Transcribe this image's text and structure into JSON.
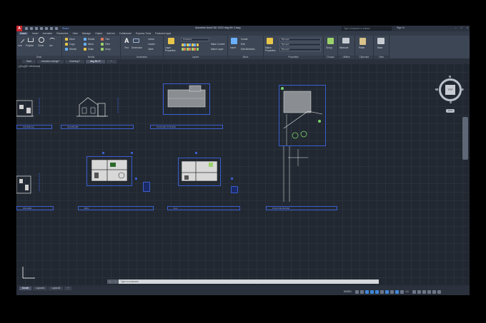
{
  "app": {
    "logo": "A",
    "title": "Autodesk AutoCAD 2023  dwg file 3.dwg",
    "share": "Share",
    "search_placeholder": "Type a keyword or phrase",
    "signin": "Sign In"
  },
  "ribbon_tabs": [
    "Home",
    "Insert",
    "Annotate",
    "Parametric",
    "View",
    "Manage",
    "Output",
    "Add-ins",
    "Collaborate",
    "Express Tools",
    "Featured Apps"
  ],
  "ribbon": {
    "draw": {
      "title": "Draw",
      "line": "Line",
      "polyline": "Polyline",
      "circle": "Circle",
      "arc": "Arc"
    },
    "modify": {
      "title": "Modify",
      "move": "Move",
      "rotate": "Rotate",
      "trim": "Trim",
      "copy": "Copy",
      "mirror": "Mirror",
      "fillet": "Fillet",
      "stretch": "Stretch",
      "scale": "Scale",
      "array": "Array"
    },
    "annotation": {
      "title": "Annotation",
      "text": "Text",
      "dimension": "Dimension",
      "linear": "Linear",
      "leader": "Leader",
      "table": "Table"
    },
    "layers": {
      "title": "Layers",
      "layer_properties": "Layer Properties",
      "layer_value": "Unsaved",
      "make_current": "Make Current",
      "match_layer": "Match Layer"
    },
    "block": {
      "title": "Block",
      "insert": "Insert",
      "create": "Create",
      "edit": "Edit",
      "edit_attributes": "Edit Attributes"
    },
    "properties": {
      "title": "Properties",
      "match_properties": "Match Properties",
      "bylayer1": "ByLayer",
      "bylayer2": "ByLayer",
      "bylayer3": "ByLayer"
    },
    "groups": {
      "title": "Groups",
      "group": "Group"
    },
    "utilities": {
      "title": "Utilities",
      "measure": "Measure"
    },
    "clipboard": {
      "title": "Clipboard",
      "paste": "Paste"
    },
    "view": {
      "title": "View",
      "base": "Base"
    }
  },
  "doc_tabs": [
    "Start",
    "extraction-design*",
    "Drawing1*",
    "dwg file 3*"
  ],
  "view_label": "[-][Top][2D Wireframe]",
  "sheets": [
    {
      "title": "COUPE AA"
    },
    {
      "title": "COUPE BB"
    },
    {
      "title": "PLAN DE TOITURE"
    },
    {
      "title": "PLAN DE MASSE"
    },
    {
      "title": "RDC"
    },
    {
      "title": "R+1"
    },
    {
      "title": "FACADE"
    }
  ],
  "viewcube": {
    "face": "TOP",
    "n": "N",
    "s": "S",
    "e": "E",
    "w": "W",
    "wcs": "WCS"
  },
  "command": {
    "placeholder": "Type a command"
  },
  "layout_tabs": [
    "Model",
    "Layout1",
    "Layout2"
  ],
  "status": {
    "model": "MODEL",
    "scale": "1:1"
  }
}
